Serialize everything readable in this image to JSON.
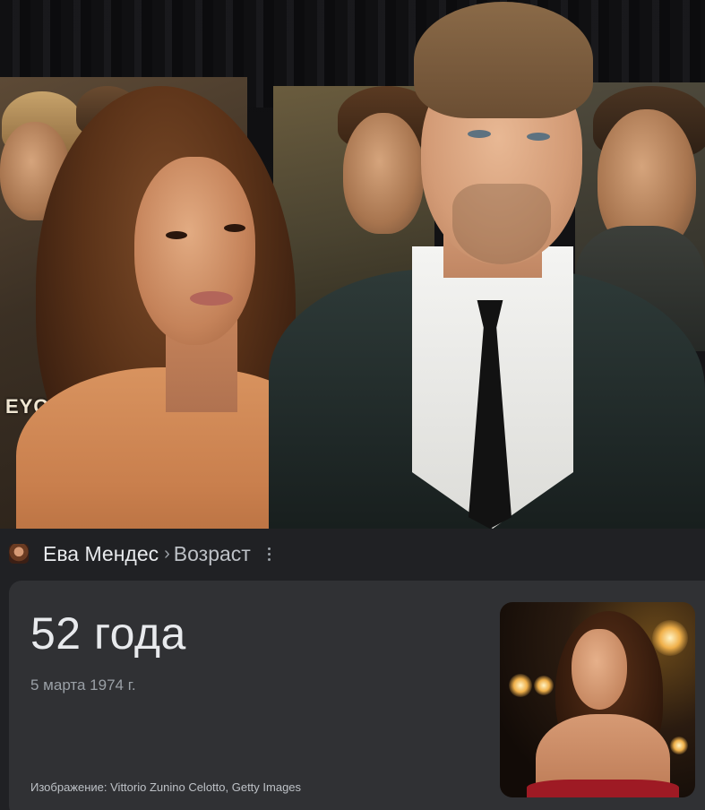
{
  "entity": {
    "thumbnail_icon": "person-thumbnail",
    "name": "Ева Мендес",
    "separator": "›",
    "attribute": "Возраст",
    "more_icon": "more-vert-icon"
  },
  "answer": {
    "age": "52 года",
    "birth_date": "5 марта 1974 г.",
    "image_credit": "Изображение: Vittorio Zunino Celotto, Getty Images"
  },
  "colors": {
    "page_background": "#202124",
    "card_background": "#303134",
    "primary_text": "#e8eaed",
    "secondary_text": "#9aa0a6"
  }
}
